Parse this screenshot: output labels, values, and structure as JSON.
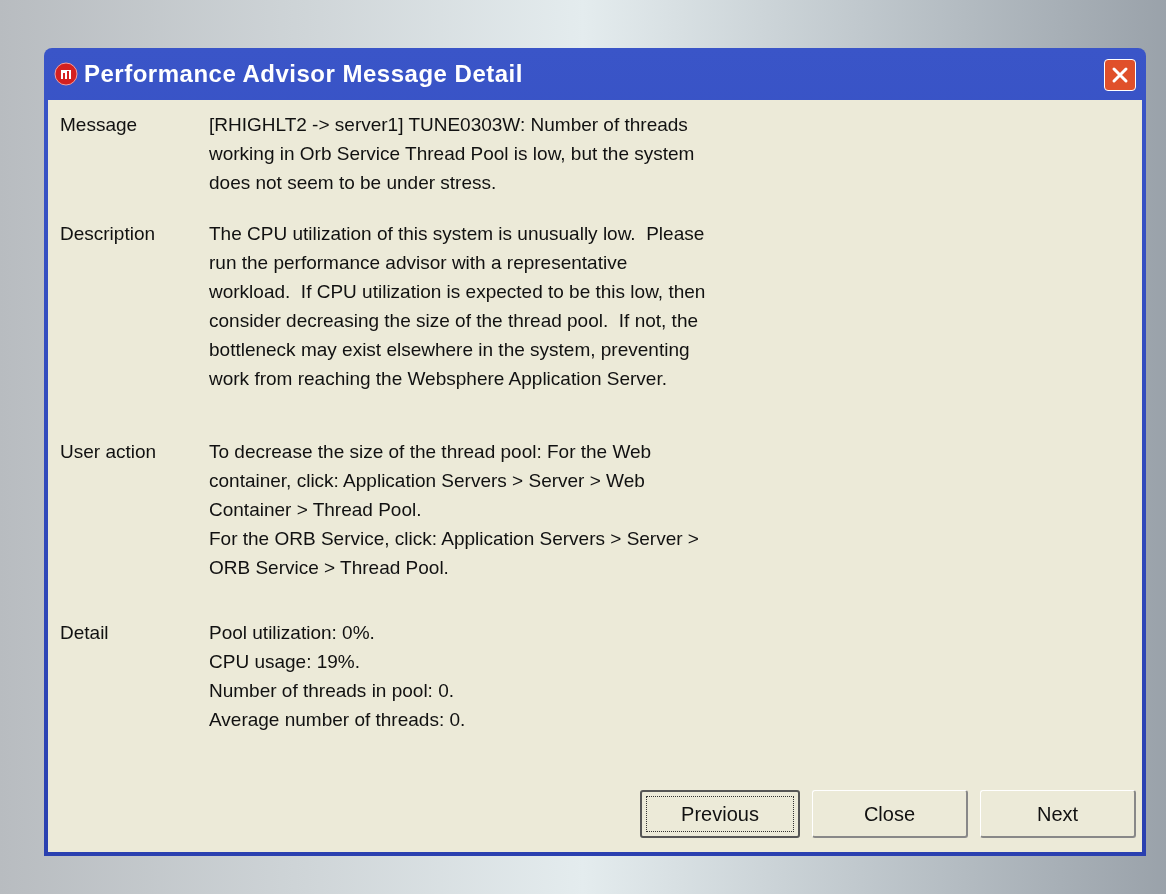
{
  "window": {
    "title": "Performance Advisor Message Detail"
  },
  "fields": [
    {
      "label": "Message",
      "paragraphs": [
        "[RHIGHLT2 -> server1] TUNE0303W: Number of threads\nworking in Orb Service Thread Pool is low, but the system\ndoes not seem to be under stress."
      ]
    },
    {
      "label": "Description",
      "paragraphs": [
        "The CPU utilization of this system is unusually low.  Please\nrun the performance advisor with a representative\nworkload.  If CPU utilization is expected to be this low, then\nconsider decreasing the size of the thread pool.  If not, the\nbottleneck may exist elsewhere in the system, preventing\nwork from reaching the Websphere Application Server."
      ]
    },
    {
      "label": "User action",
      "paragraphs": [
        "To decrease the size of the thread pool: For the Web\ncontainer, click: Application Servers > Server > Web\nContainer > Thread Pool.",
        "For the ORB Service, click: Application Servers > Server >\nORB Service > Thread Pool."
      ]
    },
    {
      "label": "Detail",
      "paragraphs": [
        "Pool utilization: 0%.",
        "CPU usage: 19%.",
        "Number of threads in pool: 0.",
        "Average number of threads: 0."
      ]
    }
  ],
  "buttons": [
    {
      "label": "Previous",
      "focused": true
    },
    {
      "label": "Close",
      "focused": false
    },
    {
      "label": "Next",
      "focused": false
    }
  ]
}
